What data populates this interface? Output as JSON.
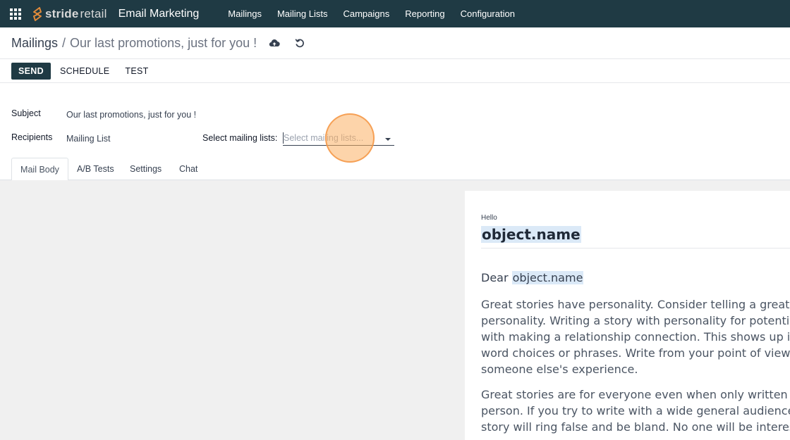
{
  "navbar": {
    "brand_part1": "stride",
    "brand_part2": "retail",
    "app_name": "Email Marketing",
    "menu": [
      "Mailings",
      "Mailing Lists",
      "Campaigns",
      "Reporting",
      "Configuration"
    ]
  },
  "breadcrumb": {
    "root": "Mailings",
    "separator": "/",
    "current": "Our last promotions, just for you !"
  },
  "actions": {
    "send": "SEND",
    "schedule": "SCHEDULE",
    "test": "TEST"
  },
  "form": {
    "subject_label": "Subject",
    "subject_value": "Our last promotions, just for you !",
    "recipients_label": "Recipients",
    "recipients_value": "Mailing List",
    "lists_label": "Select mailing lists:",
    "lists_placeholder": "Select mailing lists..."
  },
  "tabs": [
    "Mail Body",
    "A/B Tests",
    "Settings",
    "Chat"
  ],
  "mail_body": {
    "hello": "Hello",
    "title_placeholder": "object.name",
    "dear": "Dear",
    "dear_placeholder": "object.name",
    "paragraph1_lines": [
      "Great stories have personality. Consider telling a great st",
      "personality. Writing a story with personality for potential",
      "with making a relationship connection. This shows up in",
      "word choices or phrases. Write from your point of view, n",
      "someone else's experience."
    ],
    "paragraph2_lines": [
      "Great stories are for everyone even when only written fo",
      "person. If you try to write with a wide general audience",
      "story will ring false and be bland. No one will be interest"
    ]
  },
  "colors": {
    "navbar": "#1f3a44",
    "primary_button": "#1f3a44",
    "placeholder_highlight": "#dbe9f7",
    "click_indicator": "#fcb064"
  },
  "icons": [
    "apps-grid-icon",
    "brand-logo-icon",
    "cloud-upload-icon",
    "undo-icon",
    "dropdown-arrow-icon"
  ]
}
